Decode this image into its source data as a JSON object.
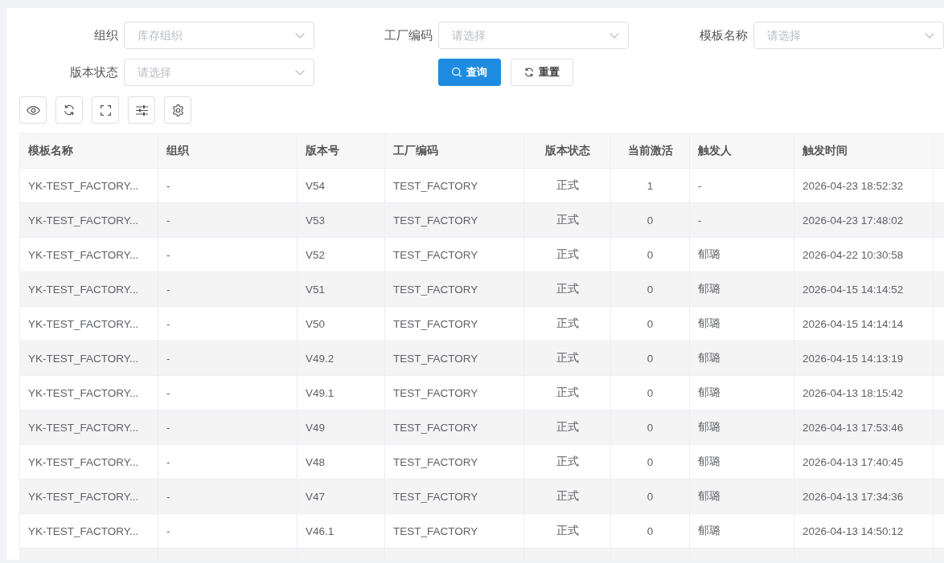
{
  "filters": [
    {
      "label": "组织",
      "placeholder": "库存组织"
    },
    {
      "label": "工厂编码",
      "placeholder": "请选择"
    },
    {
      "label": "模板名称",
      "placeholder": "请选择"
    },
    {
      "label": "版本状态",
      "placeholder": "请选择"
    }
  ],
  "buttons": [
    {
      "kind": "primary",
      "label": "查询"
    },
    {
      "kind": "default",
      "label": "重置"
    }
  ],
  "table": {
    "columns": [
      "模板名称",
      "组织",
      "版本号",
      "工厂编码",
      "版本状态",
      "当前激活",
      "触发人",
      "触发时间"
    ],
    "rows": [
      [
        "YK-TEST_FACTORY...",
        "-",
        "V54",
        "TEST_FACTORY",
        "正式",
        "1",
        "-",
        "2026-04-23 18:52:32"
      ],
      [
        "YK-TEST_FACTORY...",
        "-",
        "V53",
        "TEST_FACTORY",
        "正式",
        "0",
        "-",
        "2026-04-23 17:48:02"
      ],
      [
        "YK-TEST_FACTORY...",
        "-",
        "V52",
        "TEST_FACTORY",
        "正式",
        "0",
        "郁璐",
        "2026-04-22 10:30:58"
      ],
      [
        "YK-TEST_FACTORY...",
        "-",
        "V51",
        "TEST_FACTORY",
        "正式",
        "0",
        "郁璐",
        "2026-04-15 14:14:52"
      ],
      [
        "YK-TEST_FACTORY...",
        "-",
        "V50",
        "TEST_FACTORY",
        "正式",
        "0",
        "郁璐",
        "2026-04-15 14:14:14"
      ],
      [
        "YK-TEST_FACTORY...",
        "-",
        "V49.2",
        "TEST_FACTORY",
        "正式",
        "0",
        "郁璐",
        "2026-04-15 14:13:19"
      ],
      [
        "YK-TEST_FACTORY...",
        "-",
        "V49.1",
        "TEST_FACTORY",
        "正式",
        "0",
        "郁璐",
        "2026-04-13 18:15:42"
      ],
      [
        "YK-TEST_FACTORY...",
        "-",
        "V49",
        "TEST_FACTORY",
        "正式",
        "0",
        "郁璐",
        "2026-04-13 17:53:46"
      ],
      [
        "YK-TEST_FACTORY...",
        "-",
        "V48",
        "TEST_FACTORY",
        "正式",
        "0",
        "郁璐",
        "2026-04-13 17:40:45"
      ],
      [
        "YK-TEST_FACTORY...",
        "-",
        "V47",
        "TEST_FACTORY",
        "正式",
        "0",
        "郁璐",
        "2026-04-13 17:34:36"
      ],
      [
        "YK-TEST_FACTORY...",
        "-",
        "V46.1",
        "TEST_FACTORY",
        "正式",
        "0",
        "郁璐",
        "2026-04-13 14:50:12"
      ]
    ]
  }
}
